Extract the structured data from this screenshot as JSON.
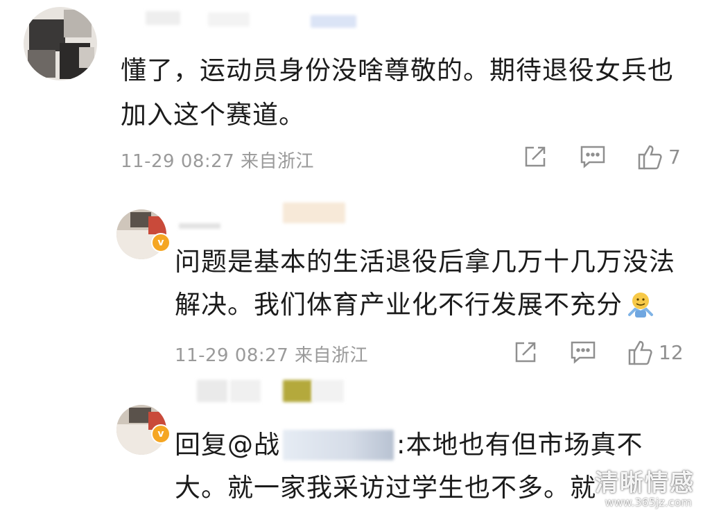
{
  "comments": [
    {
      "text_lines": [
        "懂了，运动员身份没啥尊敬的。期待退役女兵也",
        "加入这个赛道。"
      ],
      "time": "11-29 08:27",
      "location": "来自浙江",
      "likes": "7"
    },
    {
      "text_lines": [
        "问题是基本的生活退役后拿几万十几万没法",
        "解决。我们体育产业化不行发展不充分"
      ],
      "time": "11-29 08:27",
      "location": "来自浙江",
      "likes": "12",
      "emoji_icon": "shrug-emoji-icon"
    },
    {
      "reply_prefix": "回复@战",
      "reply_rest": ":本地也有但市场真不",
      "text_line2": "大。就一家我采访过学生也不多。就"
    }
  ],
  "watermark": {
    "text": "清晰情感",
    "url": "www.365jz.com"
  },
  "icons": {
    "share": "share-icon",
    "comment": "comment-icon",
    "like": "thumbs-up-icon"
  },
  "colors": {
    "text": "#1b1b1b",
    "meta": "#9a9a9a",
    "icon": "#8f8f8f"
  }
}
